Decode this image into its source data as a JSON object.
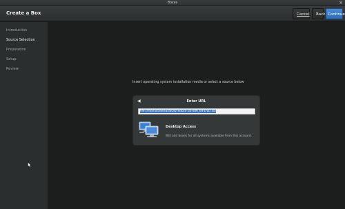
{
  "window": {
    "title": "Boxes",
    "close_glyph": "×"
  },
  "header": {
    "title": "Create a Box",
    "cancel_label": "Cancel",
    "back_label": "Back",
    "continue_label": "Continue"
  },
  "sidebar": {
    "steps": [
      {
        "label": "Introduction",
        "active": false
      },
      {
        "label": "Source Selection",
        "active": true
      },
      {
        "label": "Preparation",
        "active": false
      },
      {
        "label": "Setup",
        "active": false
      },
      {
        "label": "Review",
        "active": false
      }
    ]
  },
  "main": {
    "instruction": "Insert operating system installation media or select a source below",
    "panel": {
      "back_glyph": "◀",
      "title": "Enter URL",
      "url_value": "file:///home/zeenix/ISOs/Fedora-16-x86_64-DVD.iso",
      "desktop_title": "Desktop Access",
      "desktop_desc": "Will add boxes for all systems available from this account."
    }
  },
  "colors": {
    "accent": "#3b73b9",
    "continue_button": "#3a7bc8",
    "background": "#1c1e1e",
    "sidebar": "#2b2e2e"
  },
  "icons": [
    "close-icon",
    "back-arrow-icon",
    "desktop-computers-icon",
    "mouse-cursor-icon"
  ]
}
